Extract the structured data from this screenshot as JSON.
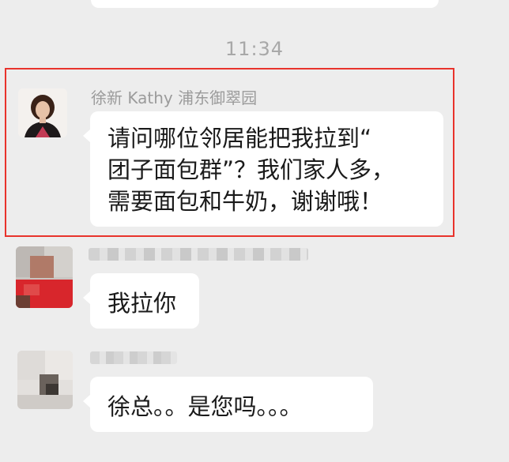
{
  "timestamp": "11:34",
  "messages": [
    {
      "sender": "徐新 Kathy 浦东御翠园",
      "text": "请问哪位邻居能把我拉到“\n团子面包群”？我们家人多，\n需要面包和牛奶，谢谢哦！",
      "highlighted": true
    },
    {
      "sender": "",
      "text": "我拉你"
    },
    {
      "sender": "",
      "text": "徐总。。是您吗。。。"
    }
  ],
  "colors": {
    "background": "#ededed",
    "bubble": "#ffffff",
    "highlight_border": "#e8332c",
    "timestamp": "#a8a8a8",
    "sender_name": "#9b9b9b"
  }
}
